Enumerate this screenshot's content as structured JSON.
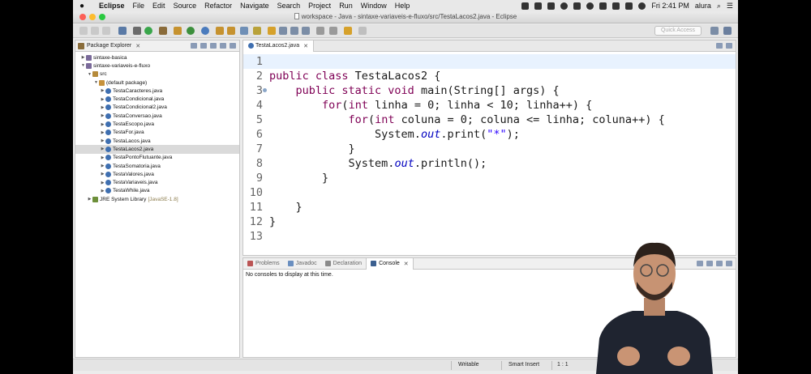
{
  "menubar": {
    "app": "Eclipse",
    "items": [
      "File",
      "Edit",
      "Source",
      "Refactor",
      "Navigate",
      "Search",
      "Project",
      "Run",
      "Window",
      "Help"
    ],
    "clock": "Fri 2:41 PM",
    "user": "alura"
  },
  "window": {
    "title": "workspace - Java - sintaxe-variaveis-e-fluxo/src/TestaLacos2.java - Eclipse"
  },
  "toolbar": {
    "quick_access": "Quick Access"
  },
  "explorer": {
    "tab_label": "Package Explorer",
    "close": "✕",
    "nodes": [
      {
        "label": "sintaxe-basica",
        "deco": "",
        "arrow": "▶"
      },
      {
        "label": "sintaxe-variaveis-e-fluxo",
        "deco": "",
        "arrow": "▼"
      },
      {
        "label": "src",
        "deco": "",
        "arrow": "▼"
      },
      {
        "label": "(default package)",
        "deco": "",
        "arrow": "▼"
      },
      {
        "label": "TestaCaracteres.java",
        "deco": "",
        "arrow": "▶"
      },
      {
        "label": "TestaCondicional.java",
        "deco": "",
        "arrow": "▶"
      },
      {
        "label": "TestaCondicional2.java",
        "deco": "",
        "arrow": "▶"
      },
      {
        "label": "TestaConversao.java",
        "deco": "",
        "arrow": "▶"
      },
      {
        "label": "TestaEscopo.java",
        "deco": "",
        "arrow": "▶"
      },
      {
        "label": "TestaFor.java",
        "deco": "",
        "arrow": "▶"
      },
      {
        "label": "TestaLacos.java",
        "deco": "",
        "arrow": "▶"
      },
      {
        "label": "TestaLacos2.java",
        "deco": "",
        "arrow": "▶"
      },
      {
        "label": "TestaPontoFlutuante.java",
        "deco": "",
        "arrow": "▶"
      },
      {
        "label": "TestaSomatoria.java",
        "deco": "",
        "arrow": "▶"
      },
      {
        "label": "TestaValores.java",
        "deco": "",
        "arrow": "▶"
      },
      {
        "label": "TestaVariaveis.java",
        "deco": "",
        "arrow": "▶"
      },
      {
        "label": "TestaWhile.java",
        "deco": "",
        "arrow": "▶"
      },
      {
        "label": "JRE System Library",
        "deco": "[JavaSE-1.8]",
        "arrow": "▶"
      }
    ],
    "selected_index": 11
  },
  "editor": {
    "tab_label": "TestaLacos2.java",
    "close": "✕",
    "current_line": 1,
    "lines": [
      {
        "n": "1",
        "tokens": []
      },
      {
        "n": "2",
        "tokens": [
          {
            "t": "public class ",
            "c": "kw"
          },
          {
            "t": "TestaLacos2 {",
            "c": ""
          }
        ]
      },
      {
        "n": "3",
        "tokens": [
          {
            "t": "    ",
            "c": ""
          },
          {
            "t": "public static void ",
            "c": "kw"
          },
          {
            "t": "main(String[] args) {",
            "c": ""
          }
        ]
      },
      {
        "n": "4",
        "tokens": [
          {
            "t": "        ",
            "c": ""
          },
          {
            "t": "for",
            "c": "kw"
          },
          {
            "t": "(",
            "c": ""
          },
          {
            "t": "int ",
            "c": "kw"
          },
          {
            "t": "linha = 0; linha < 10; linha++) {",
            "c": ""
          }
        ]
      },
      {
        "n": "5",
        "tokens": [
          {
            "t": "            ",
            "c": ""
          },
          {
            "t": "for",
            "c": "kw"
          },
          {
            "t": "(",
            "c": ""
          },
          {
            "t": "int ",
            "c": "kw"
          },
          {
            "t": "coluna = 0; coluna <= linha; coluna++) {",
            "c": ""
          }
        ]
      },
      {
        "n": "6",
        "tokens": [
          {
            "t": "                System.",
            "c": ""
          },
          {
            "t": "out",
            "c": "it"
          },
          {
            "t": ".print(",
            "c": ""
          },
          {
            "t": "\"*\"",
            "c": "st"
          },
          {
            "t": ");",
            "c": ""
          }
        ]
      },
      {
        "n": "7",
        "tokens": [
          {
            "t": "            }",
            "c": ""
          }
        ]
      },
      {
        "n": "8",
        "tokens": [
          {
            "t": "            System.",
            "c": ""
          },
          {
            "t": "out",
            "c": "it"
          },
          {
            "t": ".println();",
            "c": ""
          }
        ]
      },
      {
        "n": "9",
        "tokens": [
          {
            "t": "        }",
            "c": ""
          }
        ]
      },
      {
        "n": "10",
        "tokens": []
      },
      {
        "n": "11",
        "tokens": [
          {
            "t": "    }",
            "c": ""
          }
        ]
      },
      {
        "n": "12",
        "tokens": [
          {
            "t": "}",
            "c": ""
          }
        ]
      },
      {
        "n": "13",
        "tokens": []
      }
    ]
  },
  "console": {
    "tabs": [
      "Problems",
      "Javadoc",
      "Declaration",
      "Console"
    ],
    "active_tab": "Console",
    "close": "✕",
    "message": "No consoles to display at this time."
  },
  "statusbar": {
    "writable": "Writable",
    "insert_mode": "Smart Insert",
    "position": "1 : 1"
  },
  "colors": {
    "keyword": "#7f0055",
    "field": "#0000c0",
    "string": "#2a00ff",
    "current_line": "#e8f2fe"
  }
}
